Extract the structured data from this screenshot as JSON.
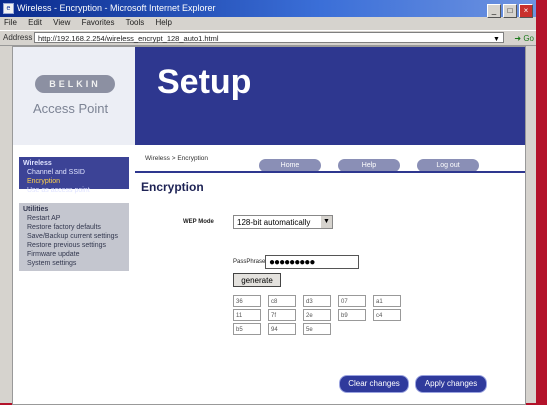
{
  "window": {
    "title": "Wireless - Encryption - Microsoft Internet Explorer",
    "controls": [
      "_",
      "□",
      "×"
    ]
  },
  "menu": [
    "File",
    "Edit",
    "View",
    "Favorites",
    "Tools",
    "Help"
  ],
  "address": {
    "label": "Address",
    "url": "http://192.168.2.254/wireless_encrypt_128_auto1.html",
    "go_label": "Go"
  },
  "brand": {
    "logo": "BELKIN",
    "product": "Access Point"
  },
  "header": {
    "title": "Setup"
  },
  "sidebar": {
    "sections": [
      {
        "heading": "Wireless",
        "items": [
          "Channel and SSID",
          "Encryption",
          "Use as access point"
        ]
      },
      {
        "heading": "Utilities",
        "items": [
          "Restart AP",
          "Restore factory defaults",
          "Save/Backup current settings",
          "Restore previous settings",
          "Firmware update",
          "System settings"
        ]
      }
    ]
  },
  "main": {
    "breadcrumb": "Wireless > Encryption",
    "top_buttons": [
      "Home",
      "Help",
      "Log out"
    ],
    "page_title": "Encryption",
    "wep_mode_label": "WEP Mode",
    "wep_mode_value": "128-bit automatically",
    "passphrase_label": "PassPhrase",
    "passphrase_value": "●●●●●●●●●",
    "generate_label": "generate",
    "keys": [
      "36",
      "c8",
      "d3",
      "07",
      "a1",
      "11",
      "7f",
      "2e",
      "b9",
      "c4",
      "b5",
      "94",
      "5e"
    ],
    "clear_label": "Clear changes",
    "apply_label": "Apply changes"
  },
  "colors": {
    "nav_blue": "#2e378f",
    "accent_red": "#b3122a"
  }
}
